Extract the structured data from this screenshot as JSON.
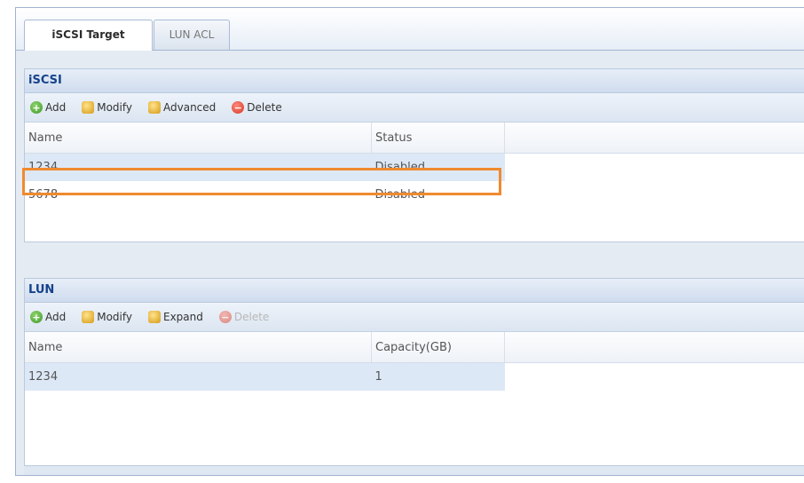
{
  "tabs": [
    {
      "label": "iSCSI Target",
      "active": true
    },
    {
      "label": "LUN ACL",
      "active": false
    }
  ],
  "iscsi": {
    "title": "iSCSI",
    "toolbar": {
      "add": "Add",
      "modify": "Modify",
      "advanced": "Advanced",
      "delete": "Delete"
    },
    "columns": [
      "Name",
      "Status"
    ],
    "rows": [
      {
        "name": "1234",
        "status": "Disabled",
        "selected": true
      },
      {
        "name": "5678",
        "status": "Disabled",
        "selected": false
      }
    ]
  },
  "lun": {
    "title": "LUN",
    "toolbar": {
      "add": "Add",
      "modify": "Modify",
      "expand": "Expand",
      "delete": "Delete"
    },
    "columns": [
      "Name",
      "Capacity(GB)"
    ],
    "rows": [
      {
        "name": "1234",
        "capacity": "1",
        "selected": true
      }
    ]
  },
  "colors": {
    "accent_title": "#15428b",
    "selection": "#dde8f6",
    "highlight_box": "#f08a2f"
  }
}
